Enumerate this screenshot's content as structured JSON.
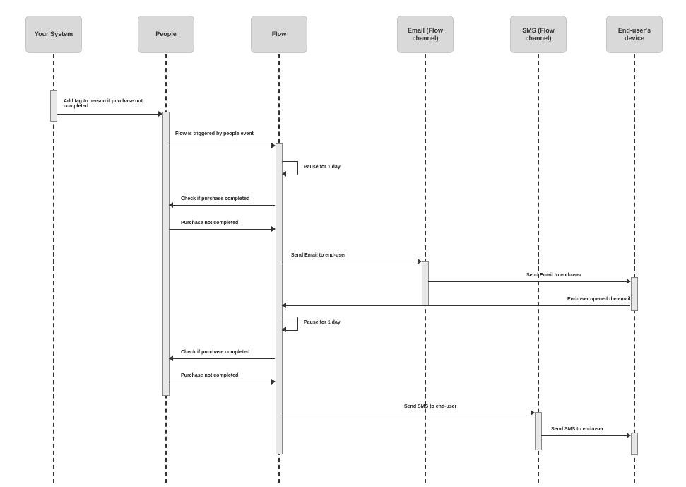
{
  "participants": {
    "your_system": "Your System",
    "people": "People",
    "flow": "Flow",
    "email": "Email (Flow channel)",
    "sms": "SMS (Flow channel)",
    "device": "End-user's device"
  },
  "messages": {
    "m1": "Add tag to person if purchase not completed",
    "m2": "Flow is triggered by people event",
    "m3": "Pause for 1 day",
    "m4": "Check if purchase completed",
    "m5": "Purchase not completed",
    "m6": "Send Email to end-user",
    "m7": "Send Email to end-user",
    "m8": "End-user opened the email",
    "m9": "Pause for 1 day",
    "m10": "Check if purchase completed",
    "m11": "Purchase not completed",
    "m12": "Send SMS to end-user",
    "m13": "Send SMS to end-user"
  }
}
